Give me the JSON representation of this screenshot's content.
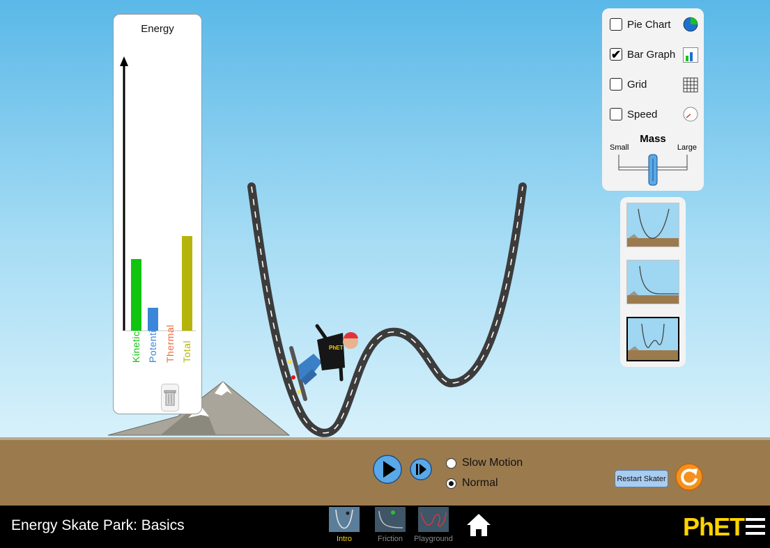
{
  "energy_chart": {
    "title": "Energy",
    "bars": [
      {
        "label": "Kinetic",
        "value": 103,
        "color": "#11c40f"
      },
      {
        "label": "Potential",
        "value": 33,
        "color": "#3b86d8"
      },
      {
        "label": "Thermal",
        "value": 0,
        "color": "#f06a3a"
      },
      {
        "label": "Total",
        "value": 136,
        "color": "#b5b40a"
      }
    ]
  },
  "controls": {
    "options": [
      {
        "label": "Pie Chart",
        "checked": false,
        "icon": "pie-chart-icon"
      },
      {
        "label": "Bar Graph",
        "checked": true,
        "icon": "bar-graph-icon"
      },
      {
        "label": "Grid",
        "checked": false,
        "icon": "grid-icon"
      },
      {
        "label": "Speed",
        "checked": false,
        "icon": "speedometer-icon"
      }
    ],
    "mass": {
      "title": "Mass",
      "min_label": "Small",
      "max_label": "Large",
      "level": 0.5
    }
  },
  "tracks": [
    {
      "name": "parabola-track",
      "selected": false
    },
    {
      "name": "slope-track",
      "selected": false
    },
    {
      "name": "double-well-track",
      "selected": true
    }
  ],
  "playback": {
    "speed_options": [
      "Slow Motion",
      "Normal"
    ],
    "selected_speed": "Normal"
  },
  "restart_label": "Restart Skater",
  "navbar": {
    "title": "Energy Skate Park: Basics",
    "tabs": [
      {
        "label": "Intro",
        "active": true
      },
      {
        "label": "Friction",
        "active": false
      },
      {
        "label": "Playground",
        "active": false
      }
    ],
    "logo": "PhET"
  },
  "colors": {
    "accent": "#ffd400",
    "play": "#5aa8e8",
    "reset": "#f5901f"
  }
}
